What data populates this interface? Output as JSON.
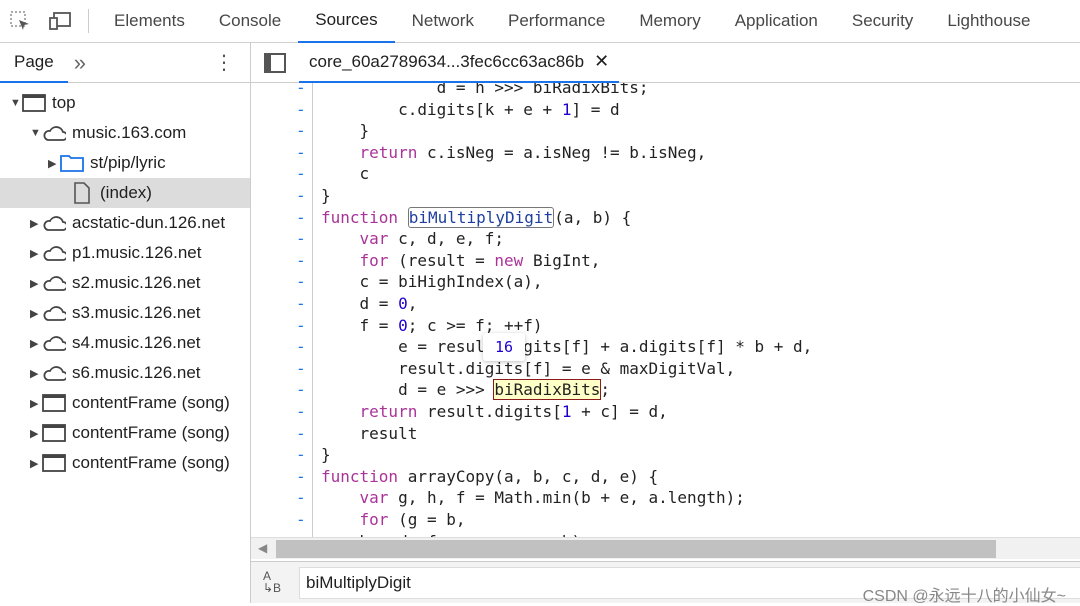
{
  "toolbar": {
    "tabs": [
      "Elements",
      "Console",
      "Sources",
      "Network",
      "Performance",
      "Memory",
      "Application",
      "Security",
      "Lighthouse"
    ],
    "active": "Sources"
  },
  "sidebar": {
    "tab": "Page",
    "more": "»",
    "tree": [
      {
        "label": "top",
        "icon": "frame-icon",
        "depth": 0,
        "expanded": true
      },
      {
        "label": "music.163.com",
        "icon": "cloud-icon",
        "depth": 1,
        "expanded": true
      },
      {
        "label": "st/pip/lyric",
        "icon": "folder-icon",
        "depth": 2,
        "expanded": false
      },
      {
        "label": "(index)",
        "icon": "file-icon",
        "depth": 2,
        "selected": true
      },
      {
        "label": "acstatic-dun.126.net",
        "icon": "cloud-icon",
        "depth": 1,
        "expanded": false
      },
      {
        "label": "p1.music.126.net",
        "icon": "cloud-icon",
        "depth": 1,
        "expanded": false
      },
      {
        "label": "s2.music.126.net",
        "icon": "cloud-icon",
        "depth": 1,
        "expanded": false
      },
      {
        "label": "s3.music.126.net",
        "icon": "cloud-icon",
        "depth": 1,
        "expanded": false
      },
      {
        "label": "s4.music.126.net",
        "icon": "cloud-icon",
        "depth": 1,
        "expanded": false
      },
      {
        "label": "s6.music.126.net",
        "icon": "cloud-icon",
        "depth": 1,
        "expanded": false
      },
      {
        "label": "contentFrame (song)",
        "icon": "frame-icon",
        "depth": 1,
        "expanded": false
      },
      {
        "label": "contentFrame (song)",
        "icon": "frame-icon",
        "depth": 1,
        "expanded": false
      },
      {
        "label": "contentFrame (song)",
        "icon": "frame-icon",
        "depth": 1,
        "expanded": false
      }
    ]
  },
  "editor": {
    "file_tab": "core_60a2789634...3fec6cc63ac86b",
    "code_lines": [
      "            d = h >>> biRadixBits;",
      "        c.digits[k + e + 1] = d",
      "    }",
      "    return c.isNeg = a.isNeg != b.isNeg,",
      "    c",
      "}",
      "function biMultiplyDigit(a, b) {",
      "    var c, d, e, f;",
      "    for (result = new BigInt,",
      "    c = biHighIndex(a),",
      "    d = 0,",
      "    f = 0; c >= f; ++f)",
      "        e = result.digits[f] + a.digits[f] * b + d,",
      "        result.digits[f] = e & maxDigitVal,",
      "        d = e >>> biRadixBits;",
      "    return result.digits[1 + c] = d,",
      "    result",
      "}",
      "function arrayCopy(a, b, c, d, e) {",
      "    var g, h, f = Math.min(b + e, a.length);",
      "    for (g = b,",
      "    h = d; f > g; ++g, ++h)"
    ],
    "hover_value": "16",
    "highlighted_word": "biRadixBits",
    "boxed_word": "biMultiplyDigit"
  },
  "search": {
    "value": "biMultiplyDigit"
  },
  "watermark": "CSDN @永远十八的小仙女~"
}
